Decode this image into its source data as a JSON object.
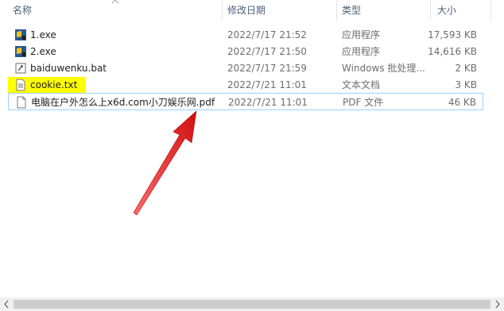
{
  "columns": {
    "name": "名称",
    "date_modified": "修改日期",
    "type": "类型",
    "size": "大小"
  },
  "files": [
    {
      "name": "1.exe",
      "date": "2022/7/17 21:52",
      "type": "应用程序",
      "size": "17,593 KB",
      "icon": "exe-icon"
    },
    {
      "name": "2.exe",
      "date": "2022/7/17 21:50",
      "type": "应用程序",
      "size": "14,616 KB",
      "icon": "exe-icon"
    },
    {
      "name": "baiduwenku.bat",
      "date": "2022/7/17 21:59",
      "type": "Windows 批处理...",
      "size": "2 KB",
      "icon": "bat-icon"
    },
    {
      "name": "cookie.txt",
      "date": "2022/7/21 11:01",
      "type": "文本文档",
      "size": "3 KB",
      "icon": "txt-icon"
    },
    {
      "name": "电脑在户外怎么上x6d.com小刀娱乐网.pdf",
      "date": "2022/7/21 11:01",
      "type": "PDF 文件",
      "size": "46 KB",
      "icon": "pdf-file-icon"
    }
  ],
  "colors": {
    "highlight": "#ffff00",
    "annotation_arrow": "#e8231f",
    "selection_border": "#99d1ff",
    "header_text": "#4c607a"
  }
}
